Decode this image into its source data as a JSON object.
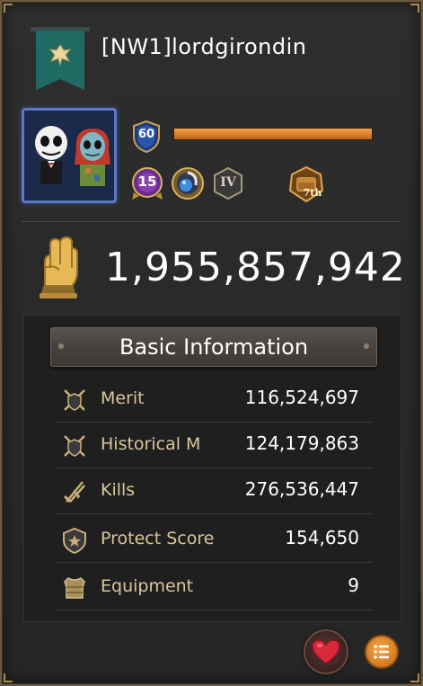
{
  "player": {
    "name": "[NW1]lordgirondin",
    "level": "60",
    "exp_fraction": 1.0
  },
  "medals": [
    {
      "icon": "rank-15-medal-icon",
      "text": "15"
    },
    {
      "icon": "blue-orb-medal-icon",
      "text": ""
    },
    {
      "icon": "tier-iv-badge-icon",
      "text": "IV"
    },
    {
      "icon": "seventh-anniversary-badge-icon",
      "text": "7th"
    }
  ],
  "power": {
    "value": "1,955,857,942"
  },
  "basic_info": {
    "title": "Basic Information",
    "rows": [
      {
        "icon": "crossed-swords-shield-icon",
        "label": "Merit",
        "value": "116,524,697"
      },
      {
        "icon": "crossed-swords-shield-icon",
        "label": "Historical M",
        "value": "124,179,863"
      },
      {
        "icon": "crossed-blades-icon",
        "label": "Kills",
        "value": "276,536,447"
      },
      {
        "icon": "shield-star-icon",
        "label": "Protect Score",
        "value": "154,650"
      },
      {
        "icon": "armor-icon",
        "label": "Equipment",
        "value": "9"
      }
    ]
  },
  "colors": {
    "accent_orange": "#e38a30",
    "label_gold": "#d8c79a",
    "banner_teal": "#1f6b63",
    "heart_red": "#d8283a"
  }
}
